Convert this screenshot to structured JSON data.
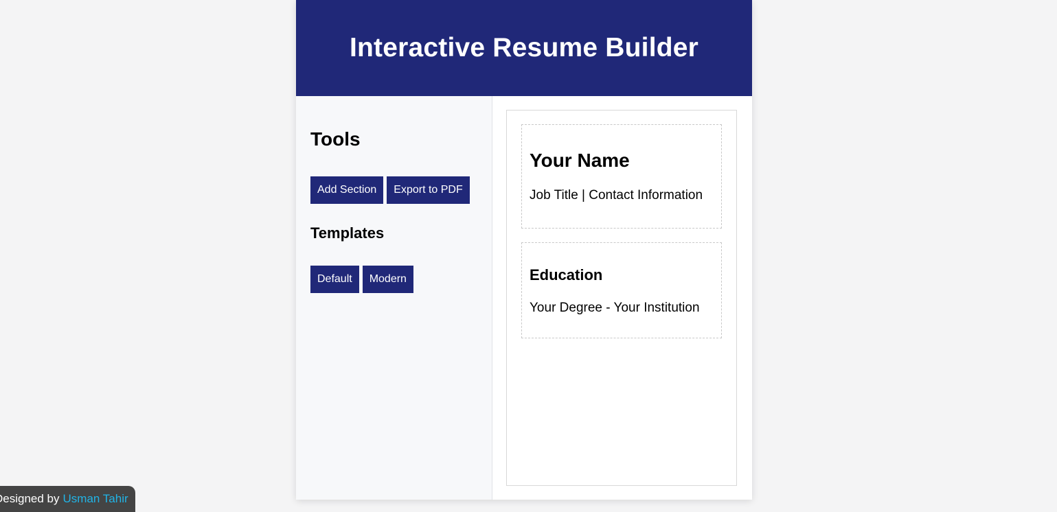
{
  "header": {
    "title": "Interactive Resume Builder"
  },
  "sidebar": {
    "tools_heading": "Tools",
    "tools_buttons": {
      "add_section": "Add Section",
      "export_pdf": "Export to PDF"
    },
    "templates_heading": "Templates",
    "template_buttons": {
      "default": "Default",
      "modern": "Modern"
    }
  },
  "resume": {
    "name_section": {
      "name": "Your Name",
      "subtitle": "Job Title | Contact Information"
    },
    "education_section": {
      "heading": "Education",
      "detail": "Your Degree - Your Institution"
    }
  },
  "credit": {
    "prefix": "Designed by",
    "author": "Usman Tahir"
  },
  "colors": {
    "primary": "#202878",
    "link": "#21b4e6",
    "credit_bg": "#444444"
  }
}
